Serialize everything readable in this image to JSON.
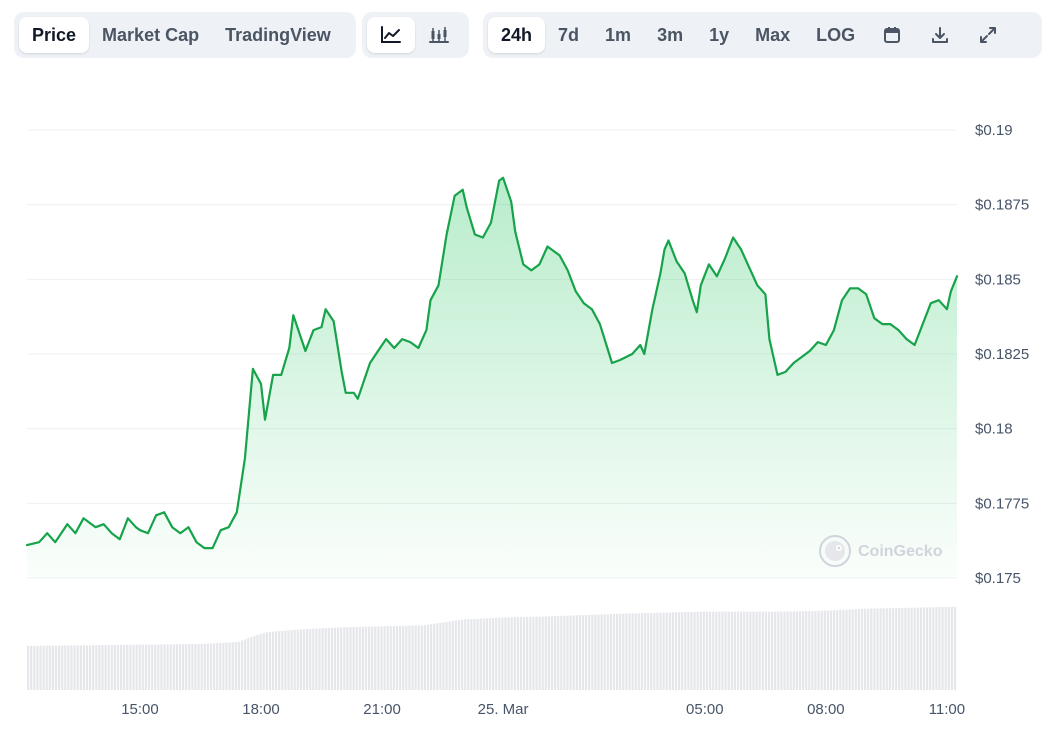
{
  "toolbar": {
    "metric_tabs": [
      "Price",
      "Market Cap",
      "TradingView"
    ],
    "active_metric": "Price",
    "chart_type_icons": [
      "line-chart-icon",
      "candlestick-icon"
    ],
    "active_chart_type": "line-chart-icon",
    "range_tabs": [
      "24h",
      "7d",
      "1m",
      "3m",
      "1y",
      "Max",
      "LOG"
    ],
    "active_range": "24h",
    "action_icons": [
      "calendar-icon",
      "download-icon",
      "expand-icon"
    ]
  },
  "watermark": "CoinGecko",
  "colors": {
    "line": "#16a34a",
    "fill": "#22c55e",
    "volume": "#e5e7eb",
    "grid": "#eef0f3"
  },
  "chart_data": {
    "type": "area",
    "title": "",
    "xlabel": "",
    "ylabel": "",
    "x_range": [
      12.2,
      35.25
    ],
    "ylim": [
      0.175,
      0.19
    ],
    "y_ticks": [
      0.175,
      0.1775,
      0.18,
      0.1825,
      0.185,
      0.1875,
      0.19
    ],
    "y_tick_labels": [
      "$0.175",
      "$0.1775",
      "$0.18",
      "$0.1825",
      "$0.185",
      "$0.1875",
      "$0.19"
    ],
    "x_ticks": [
      15,
      18,
      21,
      24,
      29,
      32,
      35
    ],
    "x_tick_labels": [
      "15:00",
      "18:00",
      "21:00",
      "25. Mar",
      "05:00",
      "08:00",
      "11:00"
    ],
    "grid": true,
    "legend": "none",
    "series": [
      {
        "values": [
          [
            12.2,
            0.1761
          ],
          [
            12.5,
            0.1762
          ],
          [
            12.7,
            0.1765
          ],
          [
            12.9,
            0.1762
          ],
          [
            13.2,
            0.1768
          ],
          [
            13.4,
            0.1765
          ],
          [
            13.6,
            0.177
          ],
          [
            13.9,
            0.1767
          ],
          [
            14.1,
            0.1768
          ],
          [
            14.3,
            0.1765
          ],
          [
            14.5,
            0.1763
          ],
          [
            14.7,
            0.177
          ],
          [
            14.9,
            0.1767
          ],
          [
            15.0,
            0.1766
          ],
          [
            15.2,
            0.1765
          ],
          [
            15.4,
            0.1771
          ],
          [
            15.6,
            0.1772
          ],
          [
            15.8,
            0.1767
          ],
          [
            16.0,
            0.1765
          ],
          [
            16.2,
            0.1767
          ],
          [
            16.4,
            0.1762
          ],
          [
            16.6,
            0.176
          ],
          [
            16.8,
            0.176
          ],
          [
            17.0,
            0.1766
          ],
          [
            17.2,
            0.1767
          ],
          [
            17.4,
            0.1772
          ],
          [
            17.6,
            0.179
          ],
          [
            17.8,
            0.182
          ],
          [
            18.0,
            0.1815
          ],
          [
            18.1,
            0.1803
          ],
          [
            18.3,
            0.1818
          ],
          [
            18.5,
            0.1818
          ],
          [
            18.7,
            0.1827
          ],
          [
            18.8,
            0.1838
          ],
          [
            19.0,
            0.183
          ],
          [
            19.1,
            0.1826
          ],
          [
            19.3,
            0.1833
          ],
          [
            19.5,
            0.1834
          ],
          [
            19.6,
            0.184
          ],
          [
            19.8,
            0.1836
          ],
          [
            20.0,
            0.1819
          ],
          [
            20.1,
            0.1812
          ],
          [
            20.3,
            0.1812
          ],
          [
            20.4,
            0.181
          ],
          [
            20.7,
            0.1822
          ],
          [
            20.9,
            0.1826
          ],
          [
            21.1,
            0.183
          ],
          [
            21.3,
            0.1827
          ],
          [
            21.5,
            0.183
          ],
          [
            21.7,
            0.1829
          ],
          [
            21.9,
            0.1827
          ],
          [
            22.1,
            0.1833
          ],
          [
            22.2,
            0.1843
          ],
          [
            22.4,
            0.1848
          ],
          [
            22.6,
            0.1865
          ],
          [
            22.8,
            0.1878
          ],
          [
            23.0,
            0.188
          ],
          [
            23.1,
            0.1874
          ],
          [
            23.3,
            0.1865
          ],
          [
            23.5,
            0.1864
          ],
          [
            23.7,
            0.1869
          ],
          [
            23.9,
            0.1883
          ],
          [
            24.0,
            0.1884
          ],
          [
            24.2,
            0.1876
          ],
          [
            24.3,
            0.1866
          ],
          [
            24.5,
            0.1855
          ],
          [
            24.7,
            0.1853
          ],
          [
            24.9,
            0.1855
          ],
          [
            25.1,
            0.1861
          ],
          [
            25.4,
            0.1858
          ],
          [
            25.6,
            0.1853
          ],
          [
            25.8,
            0.1846
          ],
          [
            26.0,
            0.1842
          ],
          [
            26.2,
            0.184
          ],
          [
            26.4,
            0.1835
          ],
          [
            26.7,
            0.1822
          ],
          [
            26.9,
            0.1823
          ],
          [
            27.2,
            0.1825
          ],
          [
            27.4,
            0.1828
          ],
          [
            27.5,
            0.1825
          ],
          [
            27.7,
            0.184
          ],
          [
            27.9,
            0.1852
          ],
          [
            28.0,
            0.186
          ],
          [
            28.1,
            0.1863
          ],
          [
            28.3,
            0.1856
          ],
          [
            28.5,
            0.1852
          ],
          [
            28.7,
            0.1843
          ],
          [
            28.8,
            0.1839
          ],
          [
            28.9,
            0.1848
          ],
          [
            29.1,
            0.1855
          ],
          [
            29.3,
            0.1851
          ],
          [
            29.5,
            0.1857
          ],
          [
            29.7,
            0.1864
          ],
          [
            29.9,
            0.186
          ],
          [
            30.1,
            0.1854
          ],
          [
            30.3,
            0.1848
          ],
          [
            30.5,
            0.1845
          ],
          [
            30.6,
            0.183
          ],
          [
            30.8,
            0.1818
          ],
          [
            31.0,
            0.1819
          ],
          [
            31.2,
            0.1822
          ],
          [
            31.4,
            0.1824
          ],
          [
            31.6,
            0.1826
          ],
          [
            31.8,
            0.1829
          ],
          [
            32.0,
            0.1828
          ],
          [
            32.2,
            0.1833
          ],
          [
            32.4,
            0.1843
          ],
          [
            32.6,
            0.1847
          ],
          [
            32.8,
            0.1847
          ],
          [
            33.0,
            0.1845
          ],
          [
            33.2,
            0.1837
          ],
          [
            33.4,
            0.1835
          ],
          [
            33.6,
            0.1835
          ],
          [
            33.8,
            0.1833
          ],
          [
            34.0,
            0.183
          ],
          [
            34.2,
            0.1828
          ],
          [
            34.4,
            0.1835
          ],
          [
            34.6,
            0.1842
          ],
          [
            34.8,
            0.1843
          ],
          [
            35.0,
            0.184
          ],
          [
            35.1,
            0.1846
          ],
          [
            35.25,
            0.1851
          ]
        ]
      }
    ],
    "volume": {
      "ylim": [
        0,
        1
      ],
      "values": [
        [
          12.2,
          0.45
        ],
        [
          14.5,
          0.46
        ],
        [
          16.5,
          0.47
        ],
        [
          17.4,
          0.49
        ],
        [
          17.8,
          0.55
        ],
        [
          18.1,
          0.59
        ],
        [
          19.0,
          0.62
        ],
        [
          20.0,
          0.64
        ],
        [
          21.0,
          0.65
        ],
        [
          22.0,
          0.66
        ],
        [
          22.5,
          0.69
        ],
        [
          23.0,
          0.72
        ],
        [
          24.0,
          0.74
        ],
        [
          25.0,
          0.75
        ],
        [
          27.0,
          0.78
        ],
        [
          29.0,
          0.8
        ],
        [
          31.0,
          0.8
        ],
        [
          32.0,
          0.81
        ],
        [
          33.0,
          0.83
        ],
        [
          35.25,
          0.85
        ]
      ]
    }
  }
}
